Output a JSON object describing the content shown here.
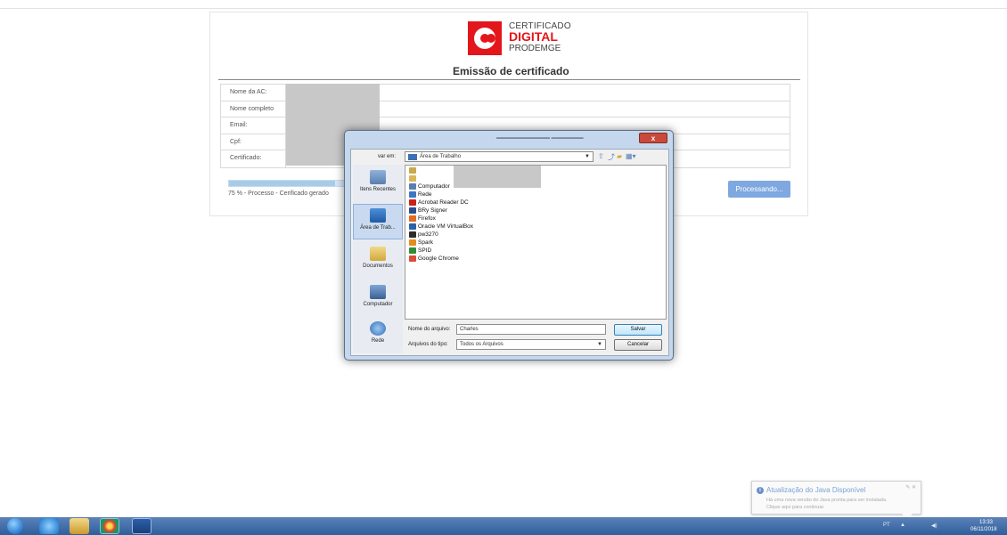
{
  "logo": {
    "line1": "CERTIFICADO",
    "line2": "DIGITAL",
    "line3": "PRODEMGE"
  },
  "form": {
    "title": "Emissão de certificado",
    "fields": [
      {
        "label": "Nome da AC:"
      },
      {
        "label": "Nome completo"
      },
      {
        "label": "Email:"
      },
      {
        "label": "Cpf:"
      },
      {
        "label": "Certificado:"
      }
    ]
  },
  "progress": {
    "percent": 75,
    "text": "75 % - Processo - Cerificado gerado"
  },
  "process_button": "Processando...",
  "dialog": {
    "save_in_label": "var em:",
    "location": "Área de Trabalho",
    "close_symbol": "x",
    "places": [
      {
        "label": "Itens Recentes",
        "icon": "recent-items-icon"
      },
      {
        "label": "Área de Trab...",
        "icon": "desktop-icon"
      },
      {
        "label": "Documentos",
        "icon": "documents-icon"
      },
      {
        "label": "Computador",
        "icon": "computer-icon"
      },
      {
        "label": "Rede",
        "icon": "network-icon"
      }
    ],
    "files": [
      {
        "name": "Computador",
        "color": "#5b7fb3"
      },
      {
        "name": "Rede",
        "color": "#3b77c2"
      },
      {
        "name": "Acrobat Reader DC",
        "color": "#c8211a"
      },
      {
        "name": "BRy Signer",
        "color": "#2b4f8c"
      },
      {
        "name": "Firefox",
        "color": "#e56b1f"
      },
      {
        "name": "Oracle VM VirtualBox",
        "color": "#2a63a8"
      },
      {
        "name": "pw3270",
        "color": "#2c2c2c"
      },
      {
        "name": "Spark",
        "color": "#e38d1e"
      },
      {
        "name": "SPID",
        "color": "#2f8c3a"
      },
      {
        "name": "Google Chrome",
        "color": "#dd4b39"
      }
    ],
    "filename_label": "Nome do arquivo:",
    "filename_value": "Charles",
    "filetype_label": "Arquivos do tipo:",
    "filetype_value": "Todos os Arquivos",
    "save_button": "Salvar",
    "cancel_button": "Cancelar"
  },
  "notification": {
    "title": "Atualização do Java Disponível",
    "line1": "Há uma nova versão do Java pronta para ser instalada.",
    "line2": "Clique aqui para continuar."
  },
  "taskbar": {
    "lang": "PT",
    "time": "13:33",
    "date": "06/11/2018"
  }
}
